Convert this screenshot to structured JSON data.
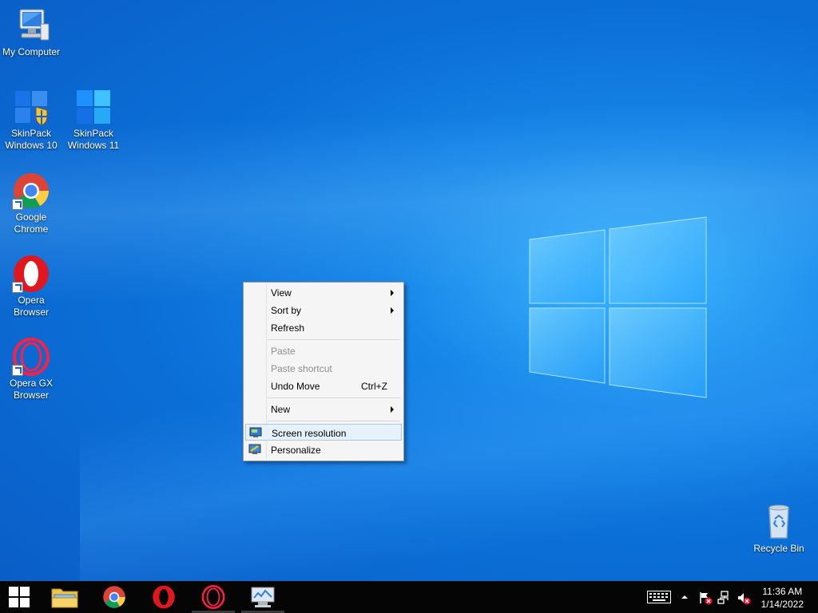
{
  "desktop_icons": [
    {
      "label": "My Computer"
    },
    {
      "label": "SkinPack Windows 10"
    },
    {
      "label": "SkinPack Windows 11"
    },
    {
      "label": "Google Chrome"
    },
    {
      "label": "Opera Browser"
    },
    {
      "label": "Opera GX Browser"
    },
    {
      "label": "Recycle Bin"
    }
  ],
  "context_menu": {
    "items": [
      {
        "label": "View",
        "submenu": true
      },
      {
        "label": "Sort by",
        "submenu": true
      },
      {
        "label": "Refresh"
      },
      {
        "label": "Paste",
        "disabled": true
      },
      {
        "label": "Paste shortcut",
        "disabled": true
      },
      {
        "label": "Undo Move",
        "shortcut": "Ctrl+Z"
      },
      {
        "label": "New",
        "submenu": true
      },
      {
        "label": "Screen resolution",
        "highlighted": true
      },
      {
        "label": "Personalize"
      }
    ]
  },
  "taskbar": {
    "pinned": [
      "start-button",
      "file-explorer",
      "google-chrome",
      "opera",
      "opera-gx",
      "control-panel"
    ],
    "clock_time": "11:36 AM",
    "clock_date": "1/14/2022"
  },
  "colors": {
    "desktop_blue": "#0b6fd8",
    "taskbar": "#050505",
    "menu_highlight": "#e5f1fb"
  }
}
